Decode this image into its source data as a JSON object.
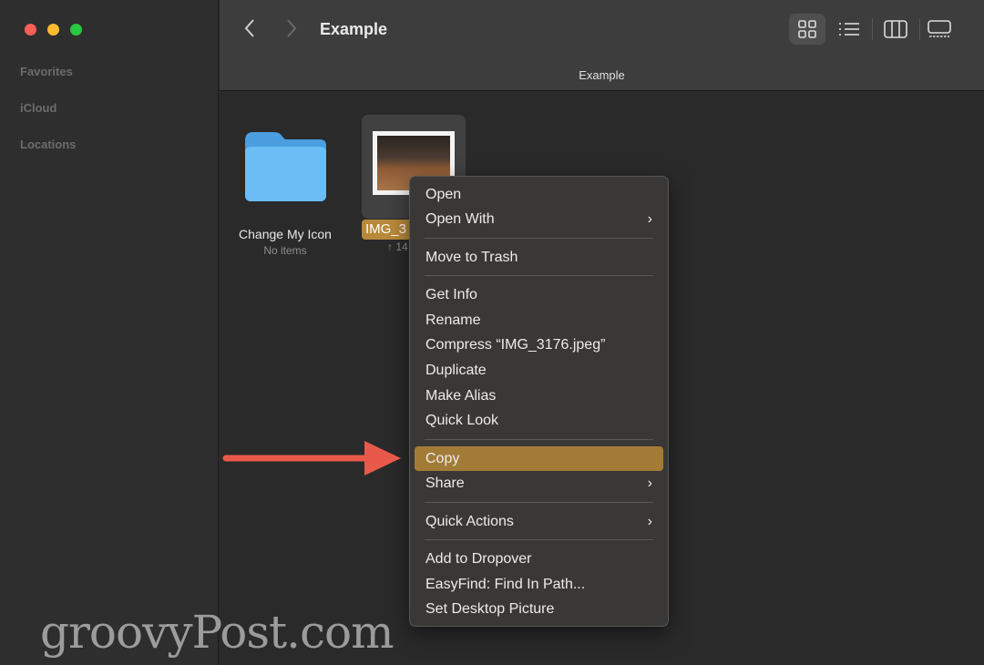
{
  "sidebar": {
    "sections": [
      "Favorites",
      "iCloud",
      "Locations"
    ]
  },
  "toolbar": {
    "title": "Example",
    "path_title": "Example",
    "back_icon": "chevron-left",
    "forward_icon": "chevron-right",
    "views": [
      "icon-view",
      "list-view",
      "column-view",
      "gallery-view"
    ],
    "active_view": "icon-view"
  },
  "files": [
    {
      "name": "Change My Icon",
      "sub": "No items",
      "icon": "folder-icon"
    },
    {
      "name": "IMG_3",
      "sub": "↑ 14",
      "icon": "image-thumbnail",
      "selected": true
    }
  ],
  "context_menu": {
    "groups": [
      [
        {
          "label": "Open"
        },
        {
          "label": "Open With",
          "submenu": true
        }
      ],
      [
        {
          "label": "Move to Trash"
        }
      ],
      [
        {
          "label": "Get Info"
        },
        {
          "label": "Rename"
        },
        {
          "label": "Compress “IMG_3176.jpeg”"
        },
        {
          "label": "Duplicate"
        },
        {
          "label": "Make Alias"
        },
        {
          "label": "Quick Look"
        }
      ],
      [
        {
          "label": "Copy",
          "highlighted": true
        },
        {
          "label": "Share",
          "submenu": true
        }
      ],
      [
        {
          "label": "Quick Actions",
          "submenu": true
        }
      ],
      [
        {
          "label": "Add to Dropover"
        },
        {
          "label": "EasyFind: Find In Path..."
        },
        {
          "label": "Set Desktop Picture"
        }
      ]
    ]
  },
  "annotation": {
    "arrow_color": "#e8594a",
    "points_to": "Copy"
  },
  "colors": {
    "highlight": "#a27c37",
    "folder": "#6cbdf5",
    "selection_label": "#b8893a"
  },
  "watermark": "groovyPost.com"
}
